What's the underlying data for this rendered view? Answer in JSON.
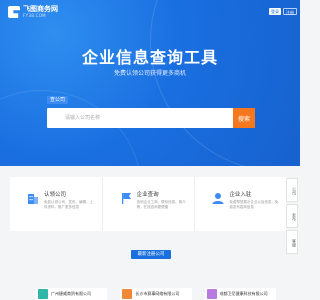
{
  "header": {
    "logo_text": "飞图商务网",
    "logo_sub": "FY38.COM",
    "login_label": "登录",
    "register_label": "注册"
  },
  "hero": {
    "title": "企业信息查询工具",
    "subtitle": "免费认领公司获得更多商机"
  },
  "search": {
    "tab_label": "查公司",
    "placeholder": "请输入公司名称",
    "button_label": "搜索"
  },
  "features": [
    {
      "title": "认领公司",
      "desc": "免费认领公司，发布、编辑、上传资料，推广更多信息",
      "icon": "building-icon",
      "color": "#3d8cf5"
    },
    {
      "title": "企业查询",
      "desc": "查询企业工商、联系信息、简介等，在线查询更便捷",
      "icon": "flag-icon",
      "color": "#3d8cf5"
    },
    {
      "title": "企业入驻",
      "desc": "免费帮您展示企业以及信息，免费发布招商信息",
      "icon": "user-icon",
      "color": "#3d8cf5"
    }
  ],
  "side_tools": [
    {
      "label": "公司"
    },
    {
      "label": "发布"
    },
    {
      "label": "客服"
    }
  ],
  "recent_label": "最新注册公司",
  "companies": [
    {
      "name": "广州捷威商贸有限公司",
      "color": "#2fb6a8"
    },
    {
      "name": "长沙市赛事网络有限公司",
      "color": "#f08a3a"
    },
    {
      "name": "成都卫尼健康科技有限公司",
      "color": "#b87ce0"
    }
  ],
  "colors": {
    "brand": "#1a6fe0",
    "accent": "#f5781e"
  }
}
